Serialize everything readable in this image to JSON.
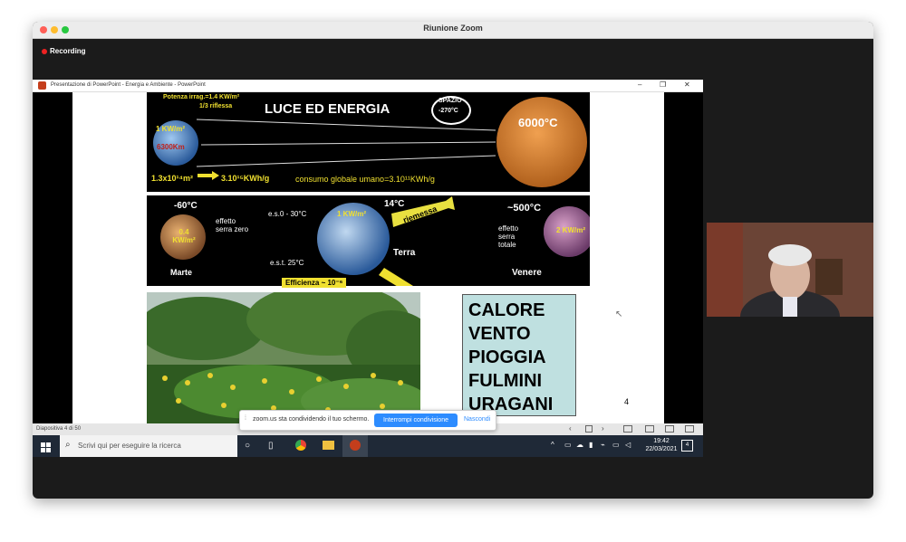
{
  "window": {
    "title": "Riunione Zoom"
  },
  "recording": {
    "label": "Recording"
  },
  "ppt": {
    "title": "Presentazione di PowerPoint  -  Energia e Ambiente - PowerPoint",
    "status": "Diapositiva 4 di 50"
  },
  "slide": {
    "heading": "LUCE  ED  ENERGIA",
    "spazio": "SPAZIO",
    "spazio_temp": "-270°C",
    "potenza": "Potenza irrag.=1.4 KW/m²",
    "riflessa": "1/3 riflessa",
    "kw_earth": "1 KW/m²",
    "km": "6300Km",
    "sun_temp": "6000°C",
    "area": "1.3x10¹⁴m²",
    "energy": "3.10¹⁵KWh/g",
    "consumo": "consumo globale umano=3.10¹¹KWh/g",
    "mars_temp": "-60°C",
    "mars_kw": "0.4 KW/m²",
    "mars_label": "Marte",
    "effetto_zero": "effetto serra zero",
    "es0": "e.s.0   - 30°C",
    "est": "e.s.t.   25°C",
    "earth_kw": "1 KW/m²",
    "earth_temp": "14°C",
    "riemessa": "riemessa",
    "terra": "Terra",
    "venus_temp": "~500°C",
    "effetto_totale": "effetto serra totale",
    "venus_kw": "2 KW/m²",
    "venere": "Venere",
    "efficienza": "Efficienza ~ 10⁻⁶",
    "calore_lines": [
      "CALORE",
      "VENTO",
      "PIOGGIA",
      "FULMINI",
      "URAGANI"
    ],
    "page_number": "4"
  },
  "share_bar": {
    "text": "zoom.us sta condividendo il tuo schermo.",
    "stop": "Interrompi condivisione",
    "hide": "Nascondi"
  },
  "taskbar": {
    "search_placeholder": "Scrivi qui per eseguire la ricerca",
    "time": "19:42",
    "date": "22/03/2021",
    "notifications": "4"
  },
  "colors": {
    "zoom_blue": "#2d8cff",
    "slide_text_yellow": "#f0e030"
  }
}
